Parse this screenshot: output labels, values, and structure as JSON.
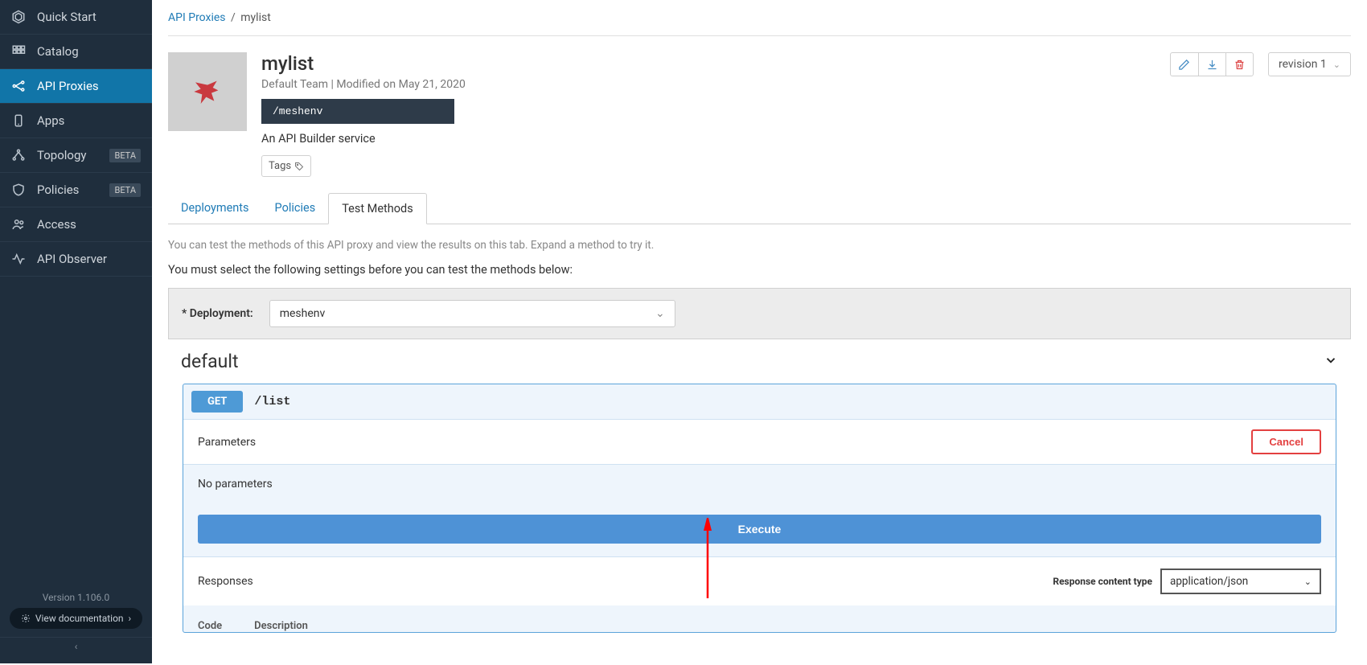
{
  "sidebar": {
    "items": [
      {
        "label": "Quick Start"
      },
      {
        "label": "Catalog"
      },
      {
        "label": "API Proxies"
      },
      {
        "label": "Apps"
      },
      {
        "label": "Topology",
        "badge": "BETA"
      },
      {
        "label": "Policies",
        "badge": "BETA"
      },
      {
        "label": "Access"
      },
      {
        "label": "API Observer"
      }
    ],
    "version": "Version 1.106.0",
    "view_docs": "View documentation"
  },
  "breadcrumb": {
    "parent": "API Proxies",
    "current": "mylist"
  },
  "header": {
    "title": "mylist",
    "subtitle": "Default Team | Modified on May 21, 2020",
    "endpoint": "/meshenv",
    "description": "An API Builder service",
    "tags_label": "Tags",
    "revision": "revision 1"
  },
  "tabs": {
    "deployments": "Deployments",
    "policies": "Policies",
    "test_methods": "Test Methods"
  },
  "hints": {
    "hint1": "You can test the methods of this API proxy and view the results on this tab. Expand a method to try it.",
    "hint2": "You must select the following settings before you can test the methods below:"
  },
  "deploy": {
    "label": "* Deployment:",
    "value": "meshenv"
  },
  "section": {
    "title": "default"
  },
  "operation": {
    "method": "GET",
    "path": "/list",
    "parameters_label": "Parameters",
    "cancel": "Cancel",
    "no_params": "No parameters",
    "execute": "Execute",
    "responses_label": "Responses",
    "response_ct_label": "Response content type",
    "response_ct_value": "application/json",
    "code_col": "Code",
    "desc_col": "Description"
  }
}
